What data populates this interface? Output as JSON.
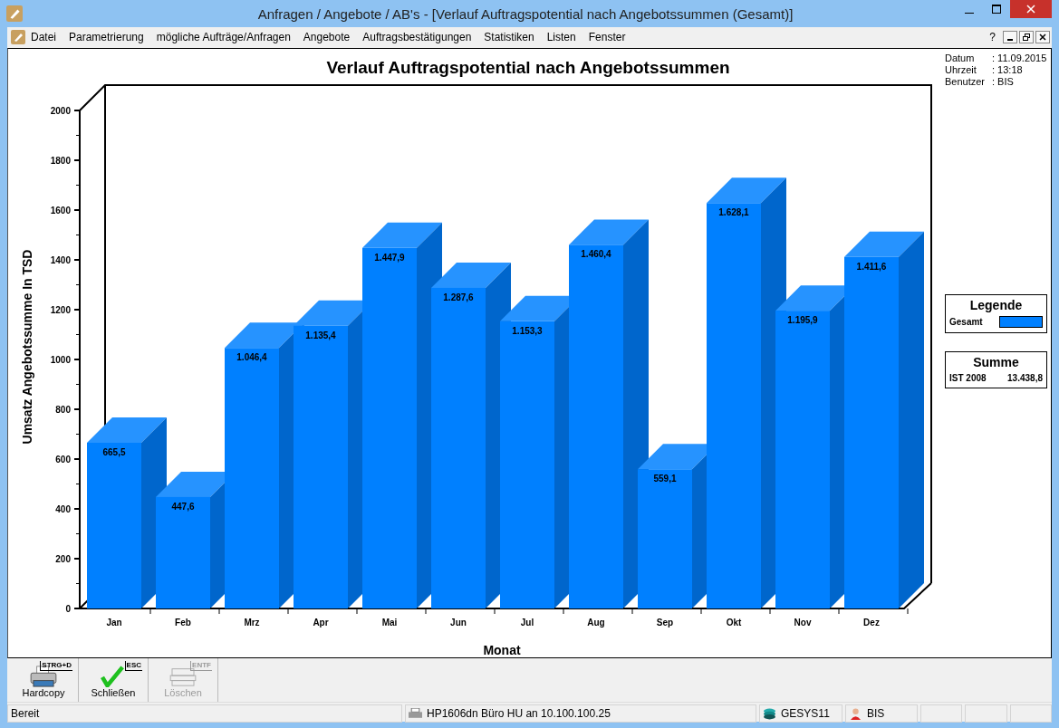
{
  "window": {
    "title": "Anfragen / Angebote / AB's - [Verlauf Auftragspotential nach Angebotssummen (Gesamt)]"
  },
  "menu": {
    "items": [
      {
        "label": "Datei"
      },
      {
        "label": "Parametrierung"
      },
      {
        "label": "mögliche Aufträge/Anfragen"
      },
      {
        "label": "Angebote"
      },
      {
        "label": "Auftragsbestätigungen"
      },
      {
        "label": "Statistiken"
      },
      {
        "label": "Listen"
      },
      {
        "label": "Fenster"
      }
    ],
    "help": "?"
  },
  "chart_panel": {
    "chart_data": {
      "type": "bar",
      "title": "Verlauf Auftragspotential nach Angebotssummen",
      "xlabel": "Monat",
      "ylabel": "Umsatz Angebotssumme In TSD",
      "categories": [
        "Jan",
        "Feb",
        "Mrz",
        "Apr",
        "Mai",
        "Jun",
        "Jul",
        "Aug",
        "Sep",
        "Okt",
        "Nov",
        "Dez"
      ],
      "series": [
        {
          "name": "Gesamt",
          "color": "#0080ff",
          "values": [
            665.5,
            447.6,
            1046.4,
            1135.4,
            1447.9,
            1287.6,
            1153.3,
            1460.4,
            559.1,
            1628.1,
            1195.9,
            1411.6
          ]
        }
      ],
      "ylim": [
        0,
        2000
      ],
      "yticks": [
        0,
        200,
        400,
        600,
        800,
        1000,
        1200,
        1400,
        1600,
        1800,
        2000
      ],
      "value_labels": [
        "665,5",
        "447,6",
        "1.046,4",
        "1.135,4",
        "1.447,9",
        "1.287,6",
        "1.153,3",
        "1.460,4",
        "559,1",
        "1.628,1",
        "1.195,9",
        "1.411,6"
      ]
    }
  },
  "info": [
    {
      "label": "Datum",
      "value": ": 11.09.2015"
    },
    {
      "label": "Uhrzeit",
      "value": ": 13:18"
    },
    {
      "label": "Benutzer",
      "value": ": BIS"
    }
  ],
  "legend": {
    "title": "Legende"
  },
  "sum": {
    "title": "Summe",
    "label": "IST 2008",
    "value": "13.438,8"
  },
  "toolbar": [
    {
      "label": "Hardcopy",
      "shortcut": "STRG+D",
      "kind": "printer",
      "disabled": false
    },
    {
      "label": "Schließen",
      "shortcut": "ESC",
      "kind": "check",
      "disabled": false
    },
    {
      "label": "Löschen",
      "shortcut": "ENTF",
      "kind": "delete",
      "disabled": true
    }
  ],
  "status_bar": [
    {
      "kind": "text",
      "text": "Bereit"
    },
    {
      "kind": "printer",
      "text": "HP1606dn Büro HU an 10.100.100.25"
    },
    {
      "kind": "database",
      "text": "GESYS11"
    },
    {
      "kind": "user",
      "text": "BIS"
    },
    {
      "kind": "empty"
    },
    {
      "kind": "empty"
    },
    {
      "kind": "empty"
    }
  ]
}
